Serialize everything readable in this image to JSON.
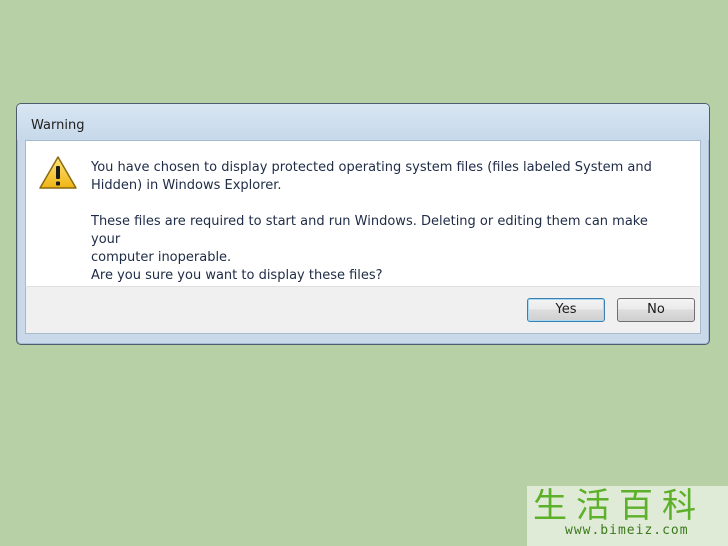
{
  "dialog": {
    "title": "Warning",
    "icon": "warning-icon",
    "message": {
      "line1": "You have chosen to display protected operating system files (files labeled System and",
      "line2": "Hidden) in Windows Explorer.",
      "line3": "These files are required to start and run Windows. Deleting or editing them can make your",
      "line4": "computer inoperable.",
      "line5": "Are you sure you want to display these files?"
    },
    "buttons": {
      "yes": "Yes",
      "no": "No"
    }
  },
  "watermark": {
    "chars": "生活百科",
    "url": "www.bimeiz.com"
  },
  "colors": {
    "background": "#b8d0a6",
    "titlebar": "#c9d9ea",
    "warning_yellow": "#f2c21b",
    "default_button_border": "#3c7fb1"
  }
}
